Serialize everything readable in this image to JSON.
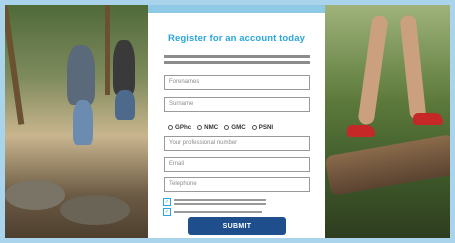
{
  "form": {
    "title": "Register for an account today",
    "fields": {
      "forenames": "Forenames",
      "surname": "Surname",
      "professional_number": "Your professional number",
      "email": "Email",
      "telephone": "Telephone"
    },
    "radio_options": [
      "GPhc",
      "NMC",
      "GMC",
      "PSNI"
    ],
    "checkbox_mark": "✓",
    "submit_label": "SUBMIT"
  }
}
